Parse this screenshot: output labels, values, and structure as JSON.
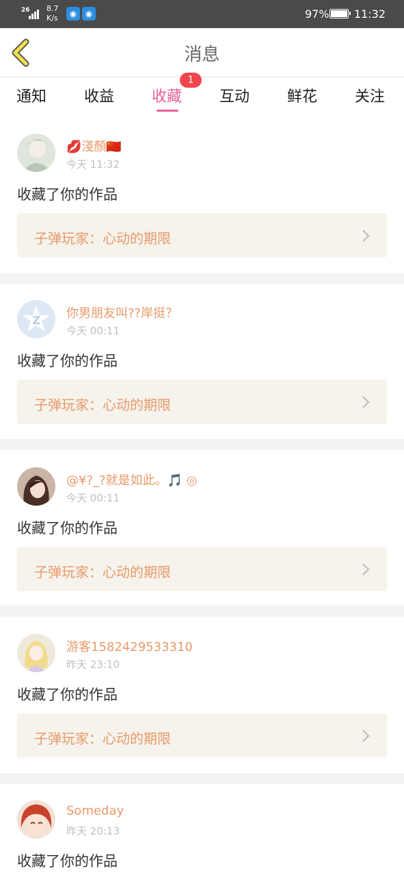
{
  "status_bar": {
    "network": "26",
    "speed_value": "8.7",
    "speed_unit": "K/s",
    "battery_percent": "97%",
    "time": "11:32",
    "icons": [
      "signal-icon",
      "hotspot-icon",
      "hotspot-icon",
      "battery-icon"
    ]
  },
  "header": {
    "title": "消息",
    "back_icon": "back-chevron-icon"
  },
  "tabs": [
    {
      "label": "通知"
    },
    {
      "label": "收益"
    },
    {
      "label": "收藏",
      "badge": "1",
      "active": true
    },
    {
      "label": "互动"
    },
    {
      "label": "鲜花"
    },
    {
      "label": "关注"
    }
  ],
  "items": [
    {
      "nickname": "💋淺顏🇨🇳",
      "time": "今天 11:32",
      "action": "收藏了你的作品",
      "work_title": "子弹玩家：心动的期限"
    },
    {
      "nickname": "你男朋友叫??岸挺？",
      "time": "今天 00:11",
      "action": "收藏了你的作品",
      "work_title": "子弹玩家：心动的期限"
    },
    {
      "nickname": "@¥?_?就是如此。🎵 ◎",
      "time": "今天 00:11",
      "action": "收藏了你的作品",
      "work_title": "子弹玩家：心动的期限"
    },
    {
      "nickname": "游客1582429533310",
      "time": "昨天 23:10",
      "action": "收藏了你的作品",
      "work_title": "子弹玩家：心动的期限"
    },
    {
      "nickname": "Someday",
      "time": "昨天 20:13",
      "action": "收藏了你的作品",
      "work_title": ""
    }
  ],
  "colors": {
    "accent": "#e8609a",
    "nickname": "#e89a6a",
    "badge": "#f0454c",
    "card_bg": "#f5f3ec"
  }
}
